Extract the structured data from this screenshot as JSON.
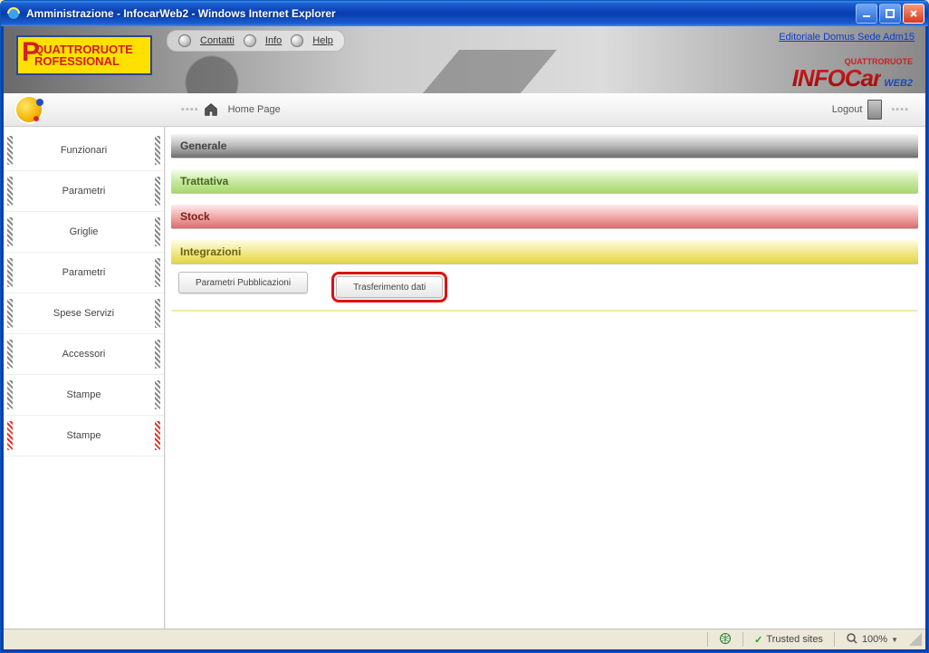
{
  "window": {
    "title": "Amministrazione - InfocarWeb2 - Windows Internet Explorer"
  },
  "banner": {
    "logo_line1": "QUATTRORUOTE",
    "logo_line2": "ROFESSIONAL",
    "link_contatti": "Contatti",
    "link_info": "Info",
    "link_help": "Help",
    "domus": "Editoriale Domus  Sede  Adm15",
    "infocar_small": "QUATTRORUOTE",
    "infocar_big": "INFOCar",
    "infocar_web": "WEB2"
  },
  "crumb": {
    "home": "Home Page",
    "logout": "Logout"
  },
  "sidebar": {
    "items": [
      {
        "label": "Funzionari"
      },
      {
        "label": "Parametri"
      },
      {
        "label": "Griglie"
      },
      {
        "label": "Parametri"
      },
      {
        "label": "Spese Servizi"
      },
      {
        "label": "Accessori"
      },
      {
        "label": "Stampe"
      },
      {
        "label": "Stampe"
      }
    ]
  },
  "sections": {
    "generale": "Generale",
    "trattativa": "Trattativa",
    "stock": "Stock",
    "integrazioni": "Integrazioni",
    "btn_param": "Parametri Pubblicazioni",
    "btn_trasf": "Trasferimento dati"
  },
  "status": {
    "trusted": "Trusted sites",
    "zoom": "100%"
  }
}
